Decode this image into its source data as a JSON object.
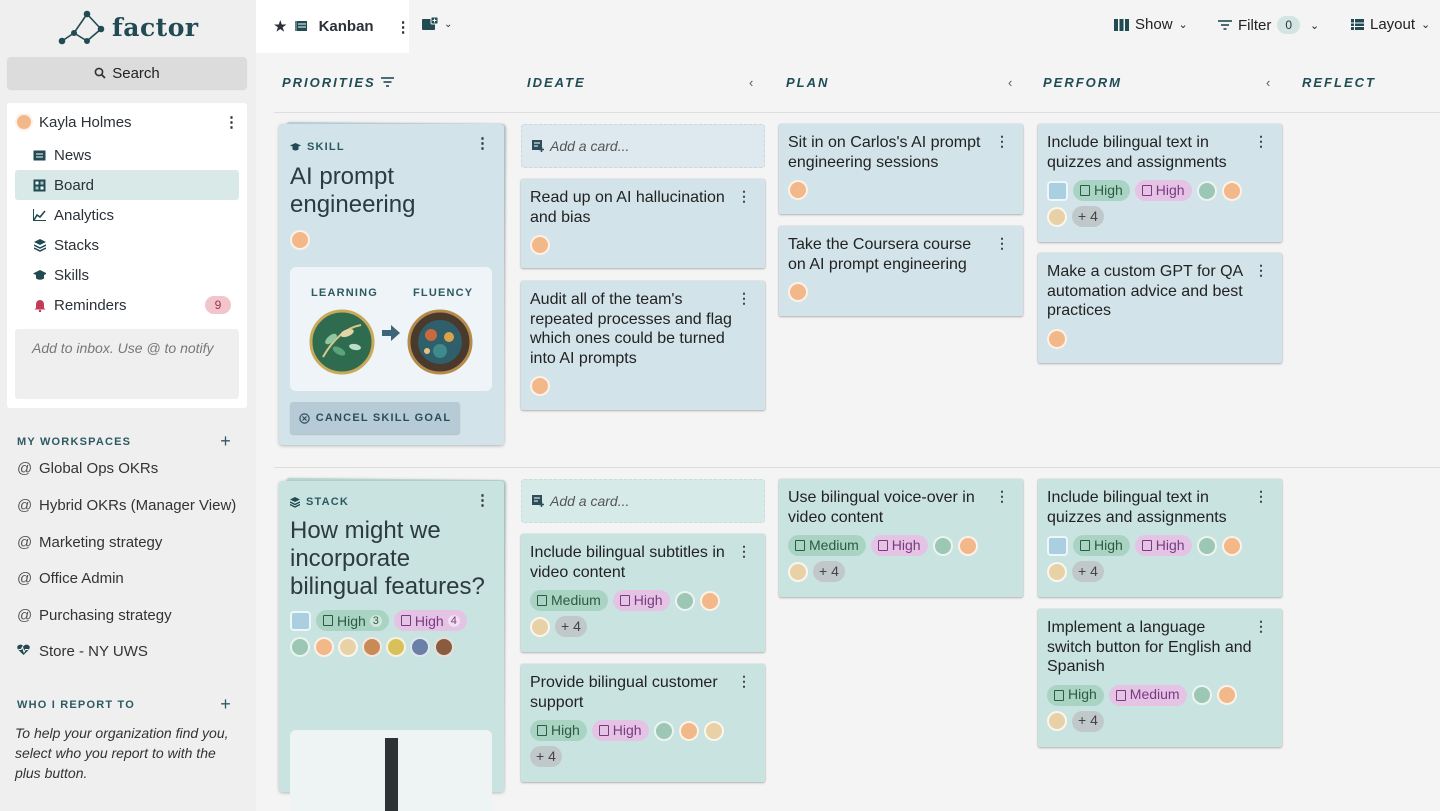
{
  "brand": {
    "name": "factor"
  },
  "search": {
    "label": "Search"
  },
  "user": {
    "name": "Kayla Holmes"
  },
  "nav": [
    {
      "label": "News",
      "icon": "news-icon"
    },
    {
      "label": "Board",
      "icon": "board-icon",
      "active": true
    },
    {
      "label": "Analytics",
      "icon": "analytics-icon"
    },
    {
      "label": "Stacks",
      "icon": "stacks-icon"
    },
    {
      "label": "Skills",
      "icon": "skills-icon"
    },
    {
      "label": "Reminders",
      "icon": "bell-icon",
      "badge": "9"
    }
  ],
  "inbox": {
    "placeholder": "Add to inbox. Use @ to notify"
  },
  "workspaces": {
    "heading": "MY WORKSPACES",
    "items": [
      "Global Ops OKRs",
      "Hybrid OKRs (Manager View)",
      "Marketing strategy",
      "Office Admin",
      "Purchasing strategy",
      "Store - NY UWS"
    ]
  },
  "report": {
    "heading": "WHO I REPORT TO",
    "text": "To help your organization find you, select who you report to with the plus button."
  },
  "topbar": {
    "tab_label": "Kanban",
    "show_label": "Show",
    "filter_label": "Filter",
    "filter_count": "0",
    "layout_label": "Layout"
  },
  "columns": {
    "priorities": "PRIORITIES",
    "ideate": "IDEATE",
    "plan": "PLAN",
    "perform": "PERFORM",
    "reflect": "REFLECT"
  },
  "add_card": "Add a card...",
  "row1": {
    "priority": {
      "type_label": "SKILL",
      "title": "AI prompt engineering",
      "from_label": "LEARNING",
      "to_label": "FLUENCY",
      "cancel_label": "CANCEL SKILL GOAL"
    },
    "ideate": [
      {
        "title": "Read up on AI hallucination and bias"
      },
      {
        "title": "Audit all of the team's repeated processes and flag which ones could be turned into AI prompts"
      }
    ],
    "plan": [
      {
        "title": "Sit in on Carlos's AI prompt engineering sessions"
      },
      {
        "title": "Take the Coursera course on AI prompt engineering"
      }
    ],
    "perform": [
      {
        "title": "Include bilingual text in quizzes and assignments",
        "pill1": "High",
        "pill2": "High",
        "more": "+ 4"
      },
      {
        "title": "Make a custom GPT for QA automation advice and best practices"
      }
    ]
  },
  "row2": {
    "priority": {
      "type_label": "STACK",
      "title": "How might we incorporate bilingual features?",
      "pill1": "High",
      "pill1_count": "3",
      "pill2": "High",
      "pill2_count": "4",
      "bar_value": 1
    },
    "ideate": [
      {
        "title": "Include bilingual subtitles in video content",
        "pill1": "Medium",
        "pill2": "High",
        "more": "+ 4"
      },
      {
        "title": "Provide bilingual customer support",
        "pill1": "High",
        "pill2": "High",
        "more": "+ 4"
      }
    ],
    "plan": [
      {
        "title": "Use bilingual voice-over in video content",
        "pill1": "Medium",
        "pill2": "High",
        "more": "+ 4"
      }
    ],
    "perform": [
      {
        "title": "Include bilingual text in quizzes and assignments",
        "pill1": "High",
        "pill2": "High",
        "more": "+ 4"
      },
      {
        "title": "Implement a language switch button for English and Spanish",
        "pill1": "High",
        "pill2": "Medium",
        "more": "+ 4"
      }
    ]
  },
  "colors": {
    "accent": "#214a52",
    "skill_card": "#d2e3e9",
    "stack_card": "#c9e3e0",
    "pill_green": "#a9d4c3",
    "pill_pink": "#e4c3e5"
  }
}
